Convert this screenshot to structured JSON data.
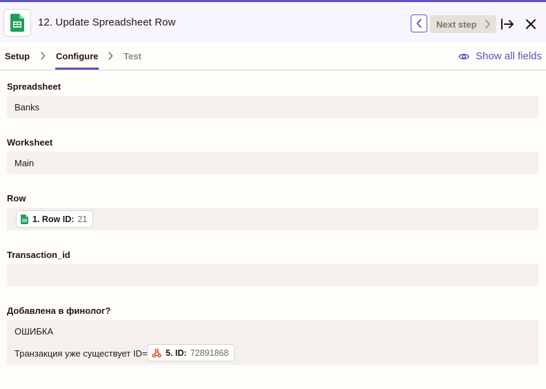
{
  "header": {
    "step_title": "12. Update Spreadsheet Row",
    "next_label": "Next step",
    "app_icon": "google-sheets-icon"
  },
  "tabs": [
    {
      "label": "Setup"
    },
    {
      "label": "Configure"
    },
    {
      "label": "Test"
    }
  ],
  "show_all_fields_label": "Show all fields",
  "colors": {
    "accent": "#5c4fc7",
    "sheets_green": "#1e9e5a",
    "webhook_orange": "#e04d1b"
  },
  "fields": {
    "spreadsheet": {
      "label": "Spreadsheet",
      "value": "Banks"
    },
    "worksheet": {
      "label": "Worksheet",
      "value": "Main"
    },
    "row": {
      "label": "Row",
      "pill": {
        "icon": "google-sheets-icon",
        "key": "1. Row ID:",
        "value": "21"
      }
    },
    "transaction_id": {
      "label": "Transaction_id",
      "value": ""
    },
    "finolog": {
      "label": "Добавлена в финолог?",
      "line1": "ОШИБКА",
      "line2_prefix": "Транзакция уже существует ID=",
      "pill": {
        "icon": "webhook-icon",
        "key": "5. ID:",
        "value": "72891868"
      }
    }
  }
}
